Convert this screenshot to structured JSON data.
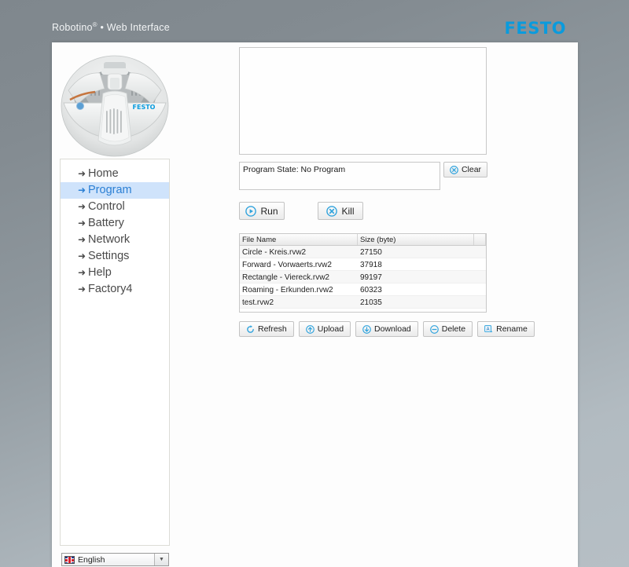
{
  "header": {
    "brand_name": "Robotino",
    "brand_sup": "®",
    "brand_separator": "•",
    "brand_subtitle": "Web Interface",
    "logo_text": "FESTO",
    "logo_color": "#0a9bdd"
  },
  "sidebar": {
    "items": [
      {
        "label": "Home",
        "icon": "arrow-right-icon",
        "active": false
      },
      {
        "label": "Program",
        "icon": "arrow-right-icon",
        "active": true
      },
      {
        "label": "Control",
        "icon": "arrow-right-icon",
        "active": false
      },
      {
        "label": "Battery",
        "icon": "arrow-right-icon",
        "active": false
      },
      {
        "label": "Network",
        "icon": "arrow-right-icon",
        "active": false
      },
      {
        "label": "Settings",
        "icon": "arrow-right-icon",
        "active": false
      },
      {
        "label": "Help",
        "icon": "arrow-right-icon",
        "active": false
      },
      {
        "label": "Factory4",
        "icon": "arrow-right-icon",
        "active": false
      }
    ],
    "active_bg": "#cfe3fb",
    "active_color": "#2a7fd4"
  },
  "language": {
    "selected": "English",
    "flag_icon": "uk-flag-icon",
    "chevron_icon": "chevron-down-icon"
  },
  "robot_image": {
    "alt": "Robotino robot top view",
    "badge_text": "FESTO"
  },
  "console": {
    "value": "",
    "placeholder": ""
  },
  "program_state": {
    "text": "Program State: No Program"
  },
  "buttons": {
    "clear": {
      "label": "Clear",
      "icon": "x-circle-icon"
    },
    "run": {
      "label": "Run",
      "icon": "play-circle-icon"
    },
    "kill": {
      "label": "Kill",
      "icon": "x-circle-icon"
    }
  },
  "file_table": {
    "columns": [
      "File Name",
      "Size (byte)",
      ""
    ],
    "rows": [
      {
        "name": "Circle - Kreis.rvw2",
        "size": "27150"
      },
      {
        "name": "Forward - Vorwaerts.rvw2",
        "size": "37918"
      },
      {
        "name": "Rectangle - Viereck.rvw2",
        "size": "99197"
      },
      {
        "name": "Roaming - Erkunden.rvw2",
        "size": "60323"
      },
      {
        "name": "test.rvw2",
        "size": "21035"
      }
    ]
  },
  "actions": [
    {
      "label": "Refresh",
      "icon": "refresh-icon"
    },
    {
      "label": "Upload",
      "icon": "upload-circle-icon"
    },
    {
      "label": "Download",
      "icon": "download-circle-icon"
    },
    {
      "label": "Delete",
      "icon": "minus-circle-icon"
    },
    {
      "label": "Rename",
      "icon": "rename-icon"
    }
  ]
}
